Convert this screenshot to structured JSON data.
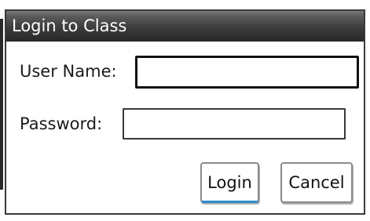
{
  "dialog": {
    "title": "Login to Class"
  },
  "form": {
    "username_label": "User Name:",
    "username_value": "",
    "password_label": "Password:",
    "password_value": ""
  },
  "buttons": {
    "login_label": "Login",
    "cancel_label": "Cancel"
  },
  "colors": {
    "titlebar": "#3c3c3c",
    "title_text": "#ffffff",
    "focus_accent": "#2e8bc9"
  }
}
